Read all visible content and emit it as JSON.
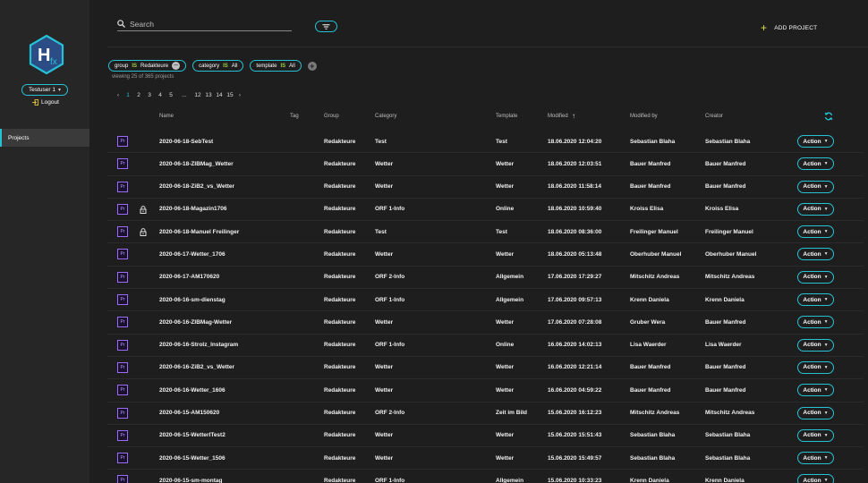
{
  "sidebar": {
    "logo_text": "H",
    "logo_sub": "fx",
    "user": "Testuser 1",
    "logout": "Logout",
    "nav": [
      {
        "label": "Projects",
        "active": true
      }
    ]
  },
  "header": {
    "search_placeholder": "Search",
    "add_project": "ADD PROJECT"
  },
  "filters": {
    "chips": [
      {
        "field": "group",
        "op": "IS",
        "value": "Redakteure",
        "removable": true
      },
      {
        "field": "category",
        "op": "IS",
        "value": "All",
        "removable": false
      },
      {
        "field": "template",
        "op": "IS",
        "value": "All",
        "removable": false
      }
    ],
    "viewing": "viewing 25 of 365 projects"
  },
  "pagination": {
    "pages": [
      "1",
      "2",
      "3",
      "4",
      "5",
      "...",
      "12",
      "13",
      "14",
      "15"
    ],
    "active": "1"
  },
  "table": {
    "headers": {
      "name": "Name",
      "tag": "Tag",
      "group": "Group",
      "category": "Category",
      "template": "Template",
      "modified": "Modified",
      "modified_by": "Modified by",
      "creator": "Creator"
    },
    "action_label": "Action",
    "app_badge": "Pr",
    "rows": [
      {
        "name": "2020-06-18-SebTest",
        "locked": false,
        "group": "Redakteure",
        "category": "Test",
        "template": "Test",
        "modified": "18.06.2020 12:04:20",
        "modified_by": "Sebastian Blaha",
        "creator": "Sebastian Blaha"
      },
      {
        "name": "2020-06-18-ZIBMag_Wetter",
        "locked": false,
        "group": "Redakteure",
        "category": "Wetter",
        "template": "Wetter",
        "modified": "18.06.2020 12:03:51",
        "modified_by": "Bauer Manfred",
        "creator": "Bauer Manfred"
      },
      {
        "name": "2020-06-18-ZiB2_vs_Wetter",
        "locked": false,
        "group": "Redakteure",
        "category": "Wetter",
        "template": "Wetter",
        "modified": "18.06.2020 11:58:14",
        "modified_by": "Bauer Manfred",
        "creator": "Bauer Manfred"
      },
      {
        "name": "2020-06-18-Magazin1706",
        "locked": true,
        "group": "Redakteure",
        "category": "ORF 1-Info",
        "template": "Online",
        "modified": "18.06.2020 10:59:40",
        "modified_by": "Kroiss Elisa",
        "creator": "Kroiss Elisa"
      },
      {
        "name": "2020-06-18-Manuel Freilinger",
        "locked": true,
        "group": "Redakteure",
        "category": "Test",
        "template": "Test",
        "modified": "18.06.2020 08:36:00",
        "modified_by": "Freilinger Manuel",
        "creator": "Freilinger Manuel"
      },
      {
        "name": "2020-06-17-Wetter_1706",
        "locked": false,
        "group": "Redakteure",
        "category": "Wetter",
        "template": "Wetter",
        "modified": "18.06.2020 05:13:48",
        "modified_by": "Oberhuber Manuel",
        "creator": "Oberhuber Manuel"
      },
      {
        "name": "2020-06-17-AM170620",
        "locked": false,
        "group": "Redakteure",
        "category": "ORF 2-Info",
        "template": "Allgemein",
        "modified": "17.06.2020 17:29:27",
        "modified_by": "Mitschitz Andreas",
        "creator": "Mitschitz Andreas"
      },
      {
        "name": "2020-06-16-sm-dienstag",
        "locked": false,
        "group": "Redakteure",
        "category": "ORF 1-Info",
        "template": "Allgemein",
        "modified": "17.06.2020 09:57:13",
        "modified_by": "Krenn Daniela",
        "creator": "Krenn Daniela"
      },
      {
        "name": "2020-06-16-ZIBMag-Wetter",
        "locked": false,
        "group": "Redakteure",
        "category": "Wetter",
        "template": "Wetter",
        "modified": "17.06.2020 07:28:08",
        "modified_by": "Gruber Wera",
        "creator": "Bauer Manfred"
      },
      {
        "name": "2020-06-16-Strolz_Instagram",
        "locked": false,
        "group": "Redakteure",
        "category": "ORF 1-Info",
        "template": "Online",
        "modified": "16.06.2020 14:02:13",
        "modified_by": "Lisa Waerder",
        "creator": "Lisa Waerder"
      },
      {
        "name": "2020-06-16-ZiB2_vs_Wetter",
        "locked": false,
        "group": "Redakteure",
        "category": "Wetter",
        "template": "Wetter",
        "modified": "16.06.2020 12:21:14",
        "modified_by": "Bauer Manfred",
        "creator": "Bauer Manfred"
      },
      {
        "name": "2020-06-16-Wetter_1606",
        "locked": false,
        "group": "Redakteure",
        "category": "Wetter",
        "template": "Wetter",
        "modified": "16.06.2020 04:59:22",
        "modified_by": "Bauer Manfred",
        "creator": "Bauer Manfred"
      },
      {
        "name": "2020-06-15-AM150620",
        "locked": false,
        "group": "Redakteure",
        "category": "ORF 2-Info",
        "template": "Zeit im Bild",
        "modified": "15.06.2020 16:12:23",
        "modified_by": "Mitschitz Andreas",
        "creator": "Mitschitz Andreas"
      },
      {
        "name": "2020-06-15-WetterITest2",
        "locked": false,
        "group": "Redakteure",
        "category": "Wetter",
        "template": "Wetter",
        "modified": "15.06.2020 15:51:43",
        "modified_by": "Sebastian Blaha",
        "creator": "Sebastian Blaha"
      },
      {
        "name": "2020-06-15-Wetter_1506",
        "locked": false,
        "group": "Redakteure",
        "category": "Wetter",
        "template": "Wetter",
        "modified": "15.06.2020 15:49:57",
        "modified_by": "Sebastian Blaha",
        "creator": "Sebastian Blaha"
      },
      {
        "name": "2020-06-15-sm-montag",
        "locked": false,
        "group": "Redakteure",
        "category": "ORF 1-Info",
        "template": "Allgemein",
        "modified": "15.06.2020 10:33:23",
        "modified_by": "Krenn Daniela",
        "creator": "Krenn Daniela"
      }
    ]
  },
  "colors": {
    "accent": "#27c1d6",
    "add_plus": "#e2e24a",
    "is_label": "#9ccf45",
    "premiere": "#9b6bff"
  }
}
